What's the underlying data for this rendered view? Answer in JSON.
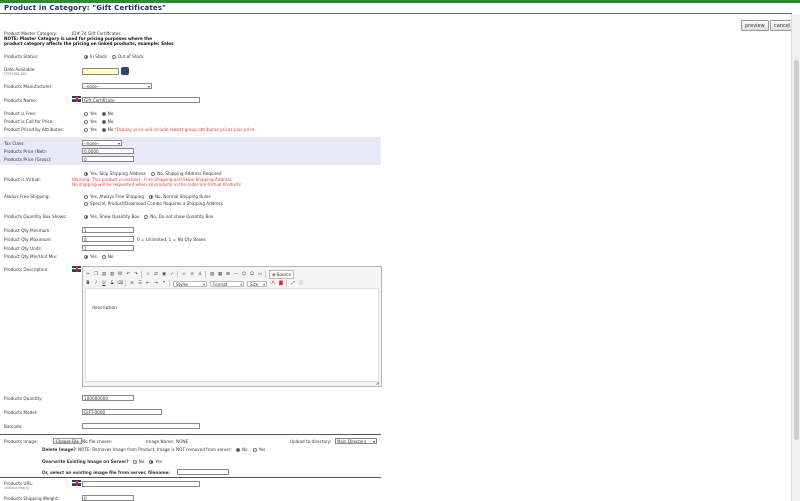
{
  "page": {
    "title": "Product in Category: \"Gift Certificates\""
  },
  "toolbar": {
    "preview_label": "preview",
    "cancel_label": "cancel"
  },
  "master_category": {
    "label": "Product Master Category:",
    "value": "ID# 74 Gift Certificates"
  },
  "note": {
    "line1": "NOTE: Master Category is used for pricing purposes where the",
    "line2": "product category affects the pricing on linked products, example: Sales"
  },
  "status": {
    "label": "Products Status:",
    "options": [
      "In Stock",
      "Out of Stock"
    ],
    "selected": "In Stock"
  },
  "date_available": {
    "label": "Date Available:",
    "hint": "(YYYY-MM-DD)",
    "value": ""
  },
  "manufacturer": {
    "label": "Products Manufacturer:",
    "value": "--none--"
  },
  "name": {
    "label": "Products Name:",
    "value": "Gift Certificate"
  },
  "is_free": {
    "label": "Product is Free:",
    "options": [
      "Yes",
      "No"
    ],
    "selected": "No"
  },
  "call_for_price": {
    "label": "Product is Call for Price:",
    "options": [
      "Yes",
      "No"
    ],
    "selected": "No"
  },
  "priced_by_attributes": {
    "label": "Product Priced by Attributes:",
    "options": [
      "Yes",
      "No"
    ],
    "selected": "No",
    "note": "*Display price will include lowest group attributes prices plus price"
  },
  "tax_class": {
    "label": "Tax Class:",
    "value": "--none--"
  },
  "price_net": {
    "label": "Products Price (Net):",
    "value": "0.0000"
  },
  "price_gross": {
    "label": "Products Price (Gross):",
    "value": "0"
  },
  "is_virtual": {
    "label": "Product is Virtual:",
    "options": [
      "Yes, Skip Shipping Address",
      "No, Shipping Address Required"
    ],
    "selected": "Yes, Skip Shipping Address",
    "warning1": "Warning: This product is marked - Free Shipping and Skips Shipping Address",
    "warning2": "No shipping will be requested when all products in the order are Virtual Products"
  },
  "free_shipping": {
    "label": "Always Free Shipping:",
    "options": [
      "Yes, Always Free Shipping",
      "No, Normal Shipping Rules",
      "Special, Product/Download Combo Requires a Shipping Address"
    ],
    "selected": "No, Normal Shipping Rules"
  },
  "qty_box": {
    "label": "Products Quantity Box Shows:",
    "options": [
      "Yes, Show Quantity Box",
      "No, Do not show Quantity Box"
    ],
    "selected": "Yes, Show Quantity Box"
  },
  "qty_minimum": {
    "label": "Product Qty Minimum:",
    "value": "1"
  },
  "qty_maximum": {
    "label": "Product Qty Maximum:",
    "value": "0",
    "hint": "0 = Unlimited, 1 = No Qty Boxes"
  },
  "qty_units": {
    "label": "Product Qty Units:",
    "value": "1"
  },
  "qty_mix": {
    "label": "Product Qty Min/Unit Mix:",
    "options": [
      "Yes",
      "No"
    ],
    "selected": "Yes"
  },
  "description": {
    "label": "Products Description:",
    "content": "description",
    "source_label": "Source",
    "styles_label": "Styles",
    "format_label": "Format",
    "size_label": "Size"
  },
  "quantity": {
    "label": "Products Quantity:",
    "value": "100000000"
  },
  "model": {
    "label": "Products Model:",
    "value": "GIFT-0000"
  },
  "barcode": {
    "label": "Barcode:",
    "value": ""
  },
  "image": {
    "label": "Products Image:",
    "choose_label": "Choose File",
    "no_file_label": "No file chosen",
    "image_name_label": "Image Name:",
    "image_name_value": "NONE",
    "upload_dir_label": "Upload to directory:",
    "upload_dir_value": "Main Directory",
    "delete_label": "Delete Image?",
    "delete_note": "NOTE: Removes Image from Product, Image is NOT removed from server:",
    "delete_options": [
      "No",
      "Yes"
    ],
    "delete_selected": "No",
    "overwrite_label": "Overwrite Existing Image on Server?",
    "overwrite_options": [
      "No",
      "Yes"
    ],
    "overwrite_selected": "Yes",
    "existing_label": "Or, select an existing image file from server, filename:"
  },
  "url": {
    "label": "Products URL:",
    "hint": "(without http://)",
    "value": ""
  },
  "shipping_weight": {
    "label": "Products Shipping Weight:",
    "value": "0"
  }
}
